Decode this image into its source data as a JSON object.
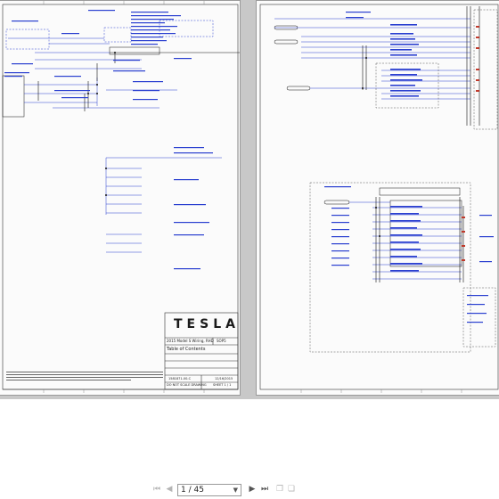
{
  "document": {
    "brand": "TESLA",
    "title_block": {
      "model": "2015 Model S Wiring, RHD",
      "variant": "SOP5",
      "sheet_title": "Table of Contents",
      "doc_number": "1581871-00-C",
      "date": "12/16/2015",
      "scale_note": "DO NOT SCALE DRAWING",
      "sheet": "SHEET 1 / 1"
    }
  },
  "toolbar": {
    "current_page": "1",
    "page_total": "45",
    "page_indicator": "1 / 45"
  },
  "colors": {
    "canvas_bg": "#c8c8c8",
    "page_bg": "#fbfbfb",
    "wire_blue": "#2a3fd0",
    "wire_black": "#111111"
  },
  "icons": {
    "first_page": "first-page-icon",
    "prev_page": "prev-page-icon",
    "next_page": "next-page-icon",
    "last_page": "last-page-icon",
    "copy": "copy-icon",
    "fit": "fit-page-icon"
  }
}
